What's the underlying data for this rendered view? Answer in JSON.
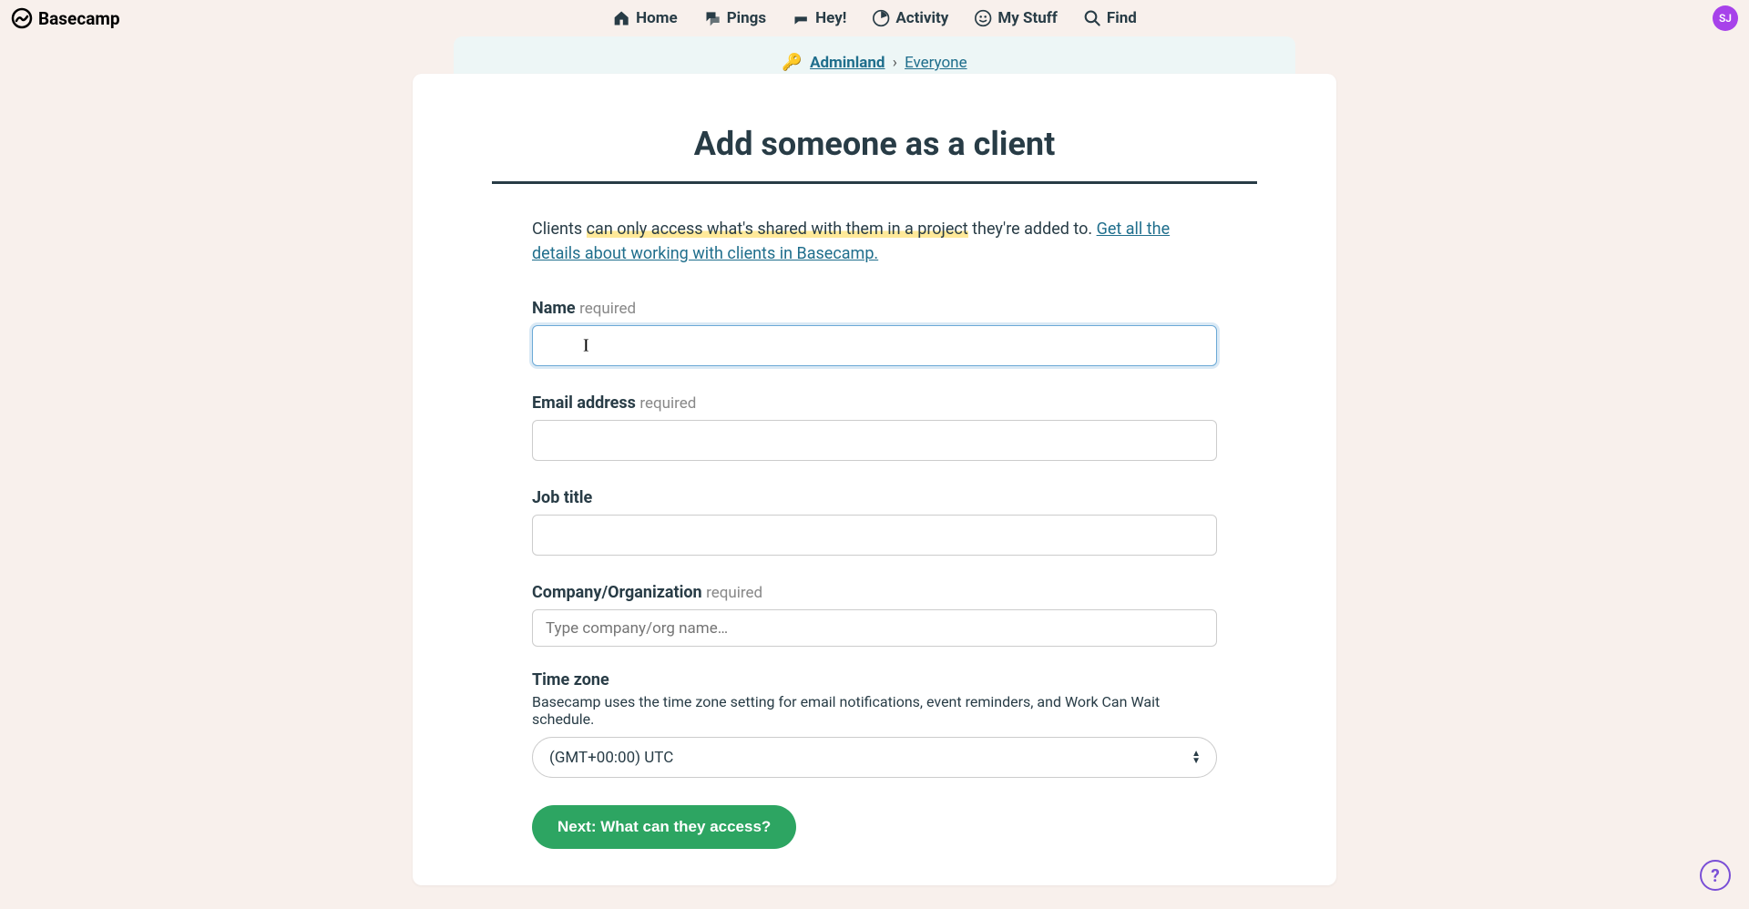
{
  "brand": "Basecamp",
  "nav": {
    "home": "Home",
    "pings": "Pings",
    "hey": "Hey!",
    "activity": "Activity",
    "mystuff": "My Stuff",
    "find": "Find"
  },
  "avatar_initials": "SJ",
  "breadcrumb": {
    "adminland": "Adminland",
    "separator": "›",
    "everyone": "Everyone"
  },
  "page_title": "Add someone as a client",
  "intro": {
    "prefix": "Clients ",
    "highlighted": "can only access what's shared with them in a project",
    "middle": " they're added to. ",
    "link": "Get all the details about working with clients in Basecamp."
  },
  "form": {
    "name_label": "Name",
    "required_text": "required",
    "email_label": "Email address",
    "jobtitle_label": "Job title",
    "company_label": "Company/Organization",
    "company_placeholder": "Type company/org name…",
    "timezone_label": "Time zone",
    "timezone_help": "Basecamp uses the time zone setting for email notifications, event reminders, and Work Can Wait schedule.",
    "timezone_value": "(GMT+00:00) UTC",
    "submit_label": "Next: What can they access?"
  },
  "help_glyph": "?"
}
